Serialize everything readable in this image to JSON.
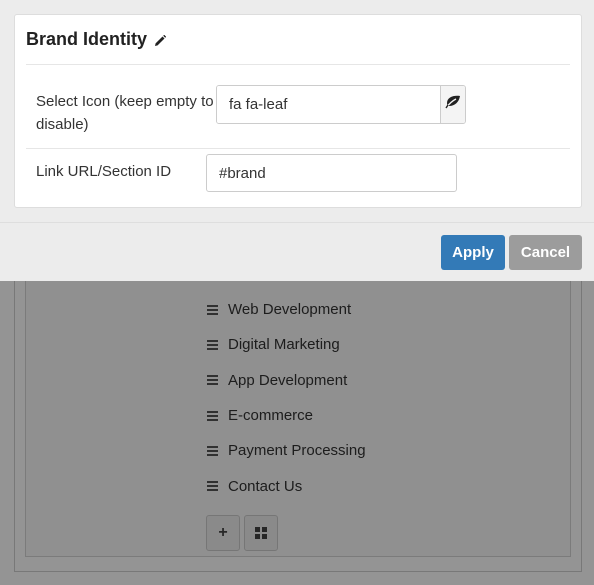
{
  "modal": {
    "title": "Brand Identity",
    "title_icon": "pencil-icon",
    "fields": {
      "icon": {
        "label": "Select Icon (keep empty to disable)",
        "value": "fa fa-leaf",
        "addon_icon": "leaf-icon"
      },
      "link": {
        "label": "Link URL/Section ID",
        "value": "#brand"
      }
    },
    "apply_label": "Apply",
    "cancel_label": "Cancel",
    "apply_color": "#337ab7",
    "cancel_color": "#9c9c9c"
  },
  "background": {
    "menu_items": [
      {
        "label": "Web Development"
      },
      {
        "label": "Digital Marketing"
      },
      {
        "label": "App Development"
      },
      {
        "label": "E-commerce"
      },
      {
        "label": "Payment Processing"
      },
      {
        "label": "Contact Us"
      }
    ],
    "add_icon": "plus-icon",
    "grid_icon": "grid-icon"
  }
}
